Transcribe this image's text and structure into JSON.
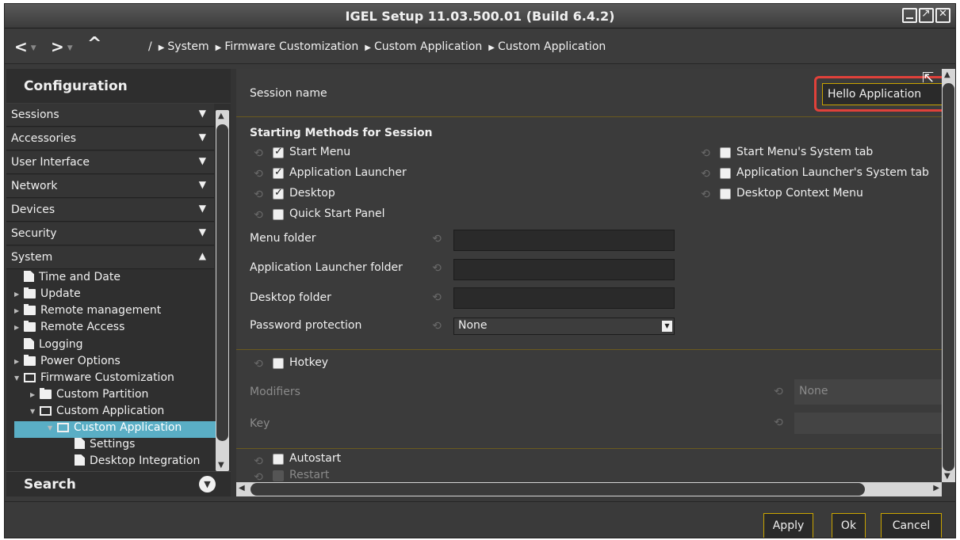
{
  "window": {
    "title": "IGEL Setup 11.03.500.01 (Build 6.4.2)"
  },
  "nav": {
    "back": "<",
    "forward": ">",
    "up": "^",
    "root": "/",
    "breadcrumbs": [
      "System",
      "Firmware Customization",
      "Custom Application",
      "Custom Application"
    ]
  },
  "sidebar": {
    "title": "Configuration",
    "items": [
      {
        "label": "Sessions",
        "state": "collapsed"
      },
      {
        "label": "Accessories",
        "state": "collapsed"
      },
      {
        "label": "User Interface",
        "state": "collapsed"
      },
      {
        "label": "Network",
        "state": "collapsed"
      },
      {
        "label": "Devices",
        "state": "collapsed"
      },
      {
        "label": "Security",
        "state": "collapsed"
      },
      {
        "label": "System",
        "state": "expanded"
      }
    ],
    "tree": [
      {
        "label": "Time and Date",
        "icon": "file-icon"
      },
      {
        "label": "Update",
        "icon": "folder-icon"
      },
      {
        "label": "Remote management",
        "icon": "folder-icon"
      },
      {
        "label": "Remote Access",
        "icon": "folder-icon"
      },
      {
        "label": "Logging",
        "icon": "file-icon"
      },
      {
        "label": "Power Options",
        "icon": "folder-icon"
      },
      {
        "label": "Firmware Customization",
        "icon": "folder-open-icon"
      },
      {
        "label": "Custom Partition",
        "icon": "folder-icon"
      },
      {
        "label": "Custom Application",
        "icon": "folder-open-icon"
      },
      {
        "label": "Custom Application",
        "icon": "folder-open-icon",
        "selected": true
      },
      {
        "label": "Settings",
        "icon": "file-icon"
      },
      {
        "label": "Desktop Integration",
        "icon": "file-icon"
      }
    ],
    "search_label": "Search"
  },
  "main": {
    "session_name_label": "Session name",
    "session_name_value": "Hello Application",
    "starting_methods_title": "Starting Methods for Session",
    "methods_left": [
      {
        "label": "Start Menu",
        "checked": true
      },
      {
        "label": "Application Launcher",
        "checked": true
      },
      {
        "label": "Desktop",
        "checked": true
      },
      {
        "label": "Quick Start Panel",
        "checked": false
      }
    ],
    "methods_right": [
      {
        "label": "Start Menu's System tab",
        "checked": false
      },
      {
        "label": "Application Launcher's System tab",
        "checked": false
      },
      {
        "label": "Desktop Context Menu",
        "checked": false
      }
    ],
    "menu_folder_label": "Menu folder",
    "app_launcher_folder_label": "Application Launcher folder",
    "desktop_folder_label": "Desktop folder",
    "password_protection_label": "Password protection",
    "password_protection_value": "None",
    "hotkey_label": "Hotkey",
    "modifiers_label": "Modifiers",
    "modifiers_value": "None",
    "key_label": "Key",
    "autostart_label": "Autostart",
    "restart_label": "Restart"
  },
  "footer": {
    "apply": "Apply",
    "ok": "Ok",
    "cancel": "Cancel"
  },
  "colors": {
    "accent": "#c9a400",
    "selection": "#5aaec5",
    "highlight": "#e0413a"
  }
}
